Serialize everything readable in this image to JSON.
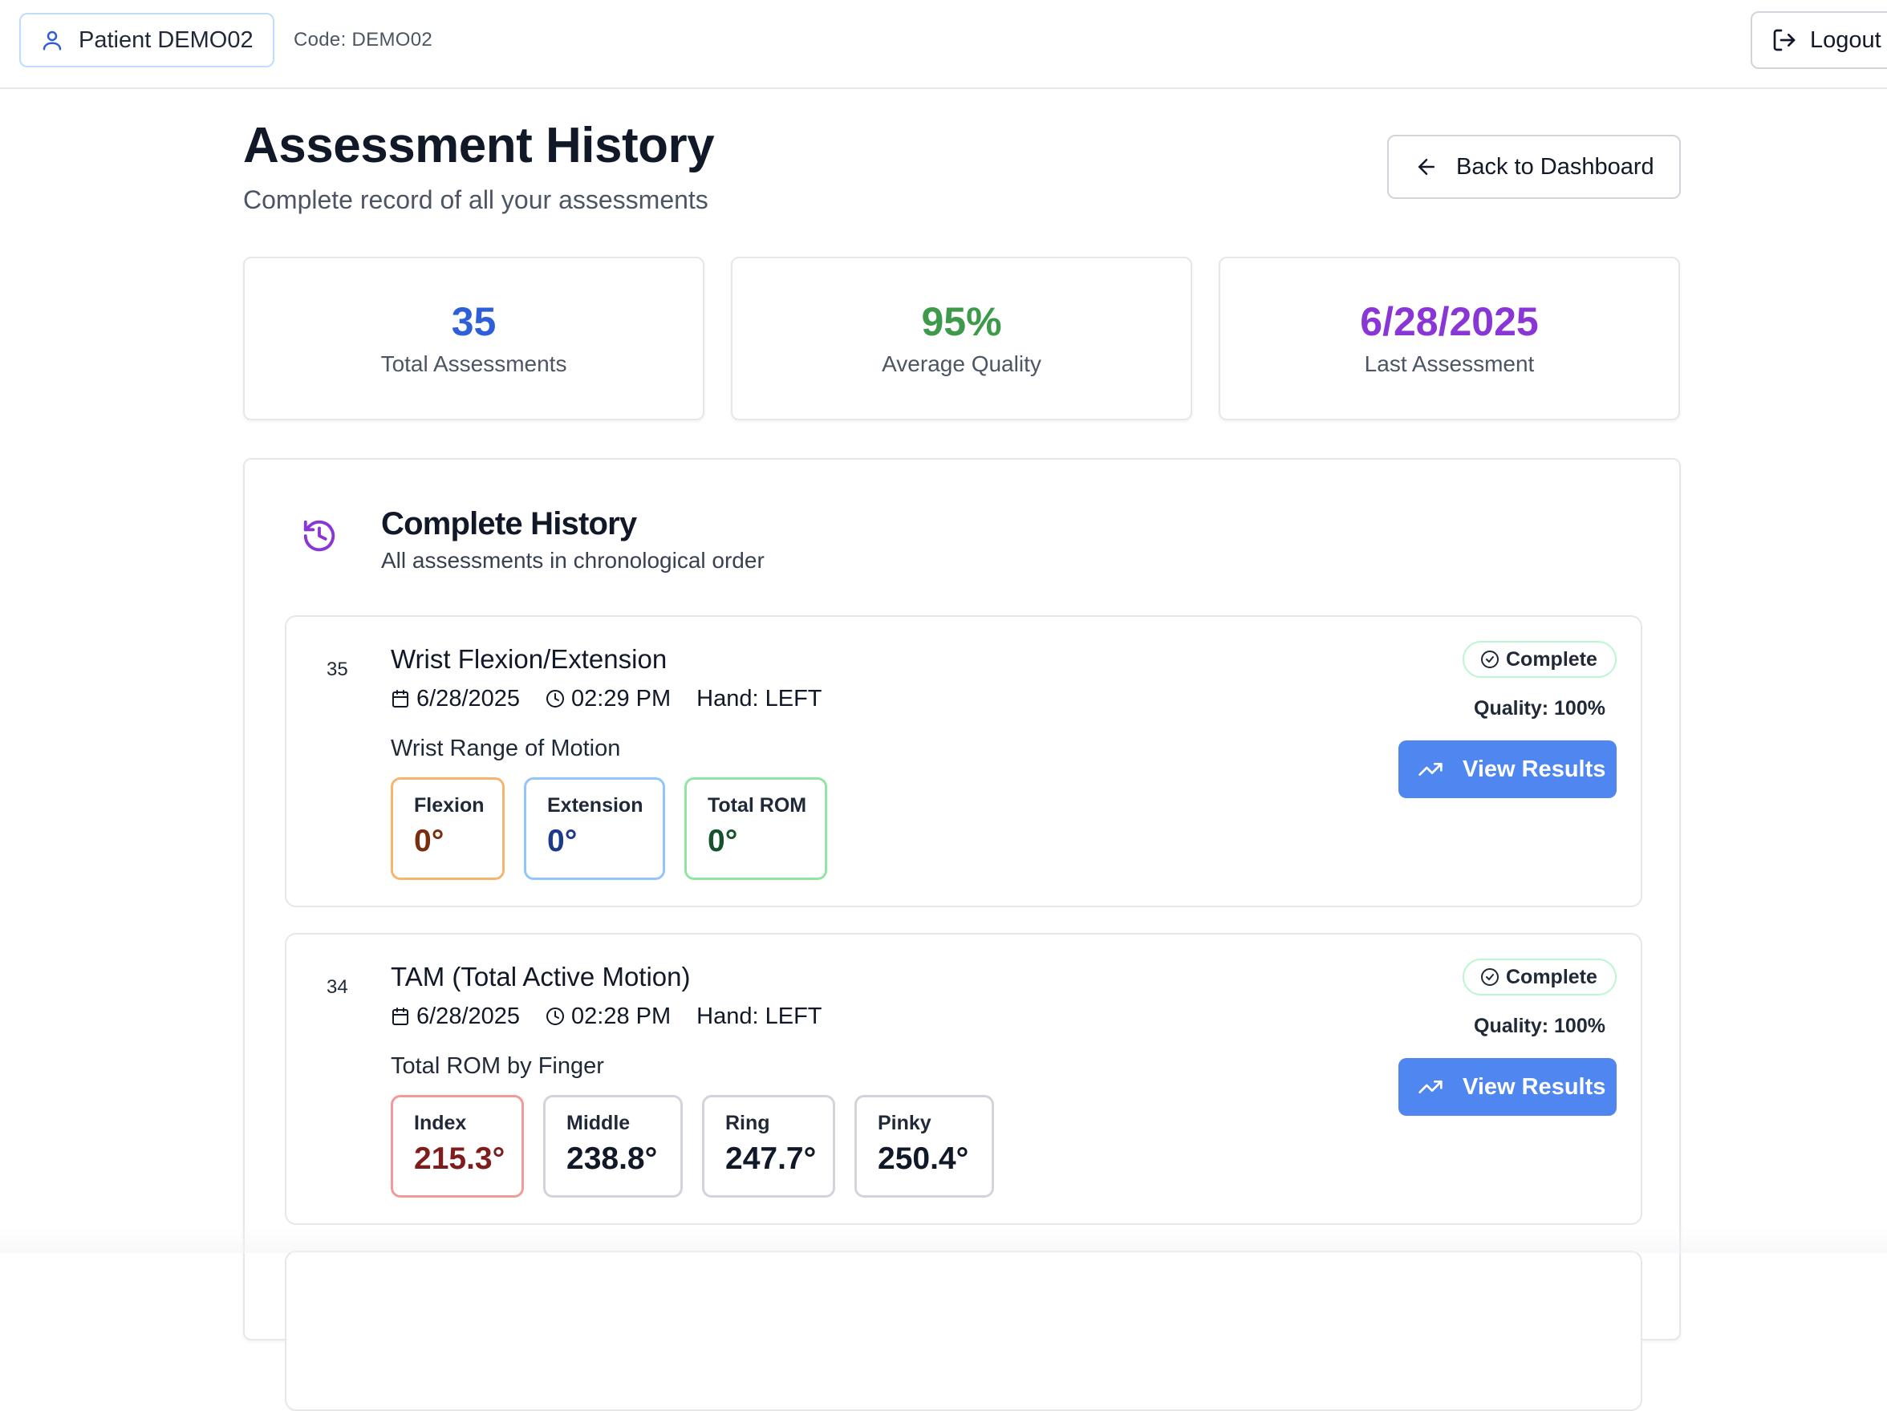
{
  "topbar": {
    "patient_label": "Patient DEMO02",
    "code_text": "Code: DEMO02",
    "logout_label": "Logout"
  },
  "header": {
    "title": "Assessment History",
    "subtitle": "Complete record of all your assessments",
    "back_label": "Back to Dashboard"
  },
  "stats": [
    {
      "value": "35",
      "label": "Total Assessments",
      "color": "#2f5fd8"
    },
    {
      "value": "95%",
      "label": "Average Quality",
      "color": "#3d9a4a"
    },
    {
      "value": "6/28/2025",
      "label": "Last Assessment",
      "color": "#8a35d6"
    }
  ],
  "history": {
    "title": "Complete History",
    "subtitle": "All assessments in chronological order",
    "icon": "history-icon",
    "entries": [
      {
        "number": "35",
        "title": "Wrist Flexion/Extension",
        "date": "6/28/2025",
        "time": "02:29 PM",
        "hand": "Hand: LEFT",
        "status": "Complete",
        "quality": "Quality: 100%",
        "action_label": "View Results",
        "metric_heading": "Wrist Range of Motion",
        "metrics": [
          {
            "label": "Flexion",
            "value": "0°",
            "border": "#f5b56c",
            "color": "#7a2e0e"
          },
          {
            "label": "Extension",
            "value": "0°",
            "border": "#93c5fd",
            "color": "#1e3a8a"
          },
          {
            "label": "Total ROM",
            "value": "0°",
            "border": "#8ee6a0",
            "color": "#14532d"
          }
        ]
      },
      {
        "number": "34",
        "title": "TAM (Total Active Motion)",
        "date": "6/28/2025",
        "time": "02:28 PM",
        "hand": "Hand: LEFT",
        "status": "Complete",
        "quality": "Quality: 100%",
        "action_label": "View Results",
        "metric_heading": "Total ROM by Finger",
        "metrics": [
          {
            "label": "Index",
            "value": "215.3°",
            "border": "#f29a9a",
            "color": "#7f1d1d"
          },
          {
            "label": "Middle",
            "value": "238.8°",
            "border": "#d1d5db",
            "color": "#111827"
          },
          {
            "label": "Ring",
            "value": "247.7°",
            "border": "#d1d5db",
            "color": "#111827"
          },
          {
            "label": "Pinky",
            "value": "250.4°",
            "border": "#d1d5db",
            "color": "#111827"
          }
        ]
      }
    ]
  },
  "colors": {
    "primary_button": "#4f86f0",
    "accent_purple": "#8a35d6",
    "badge_border": "#bbf7d0"
  }
}
